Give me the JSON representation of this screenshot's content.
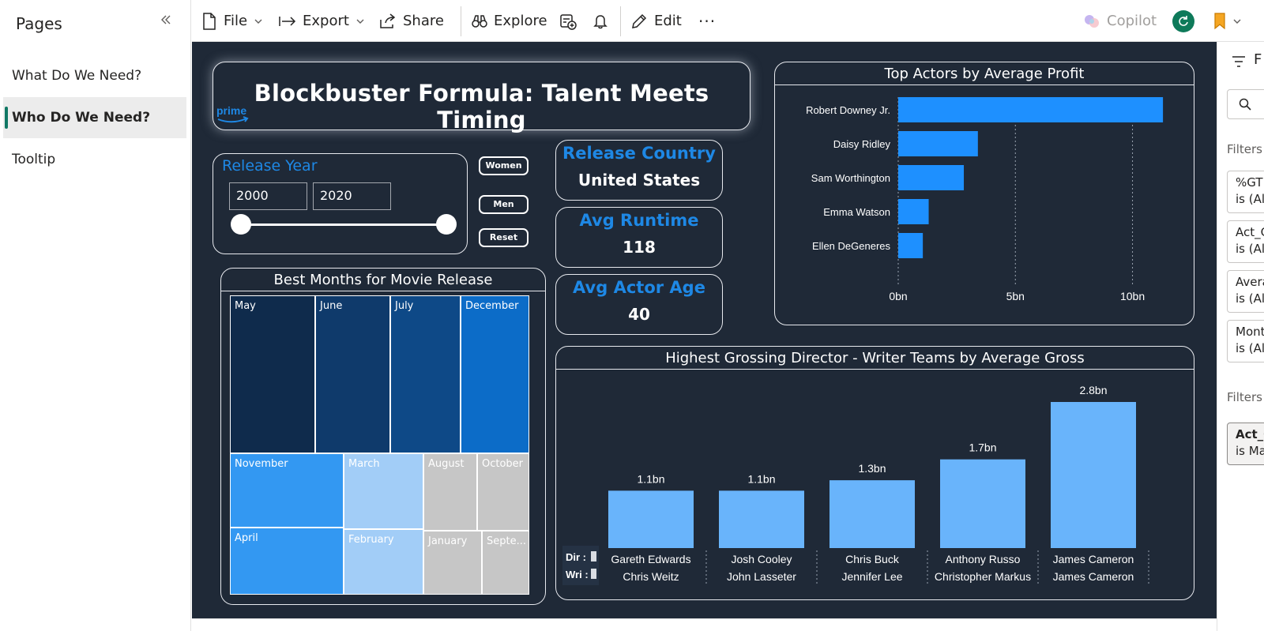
{
  "pages_pane": {
    "title": "Pages",
    "items": [
      {
        "label": "What Do We Need?",
        "active": false
      },
      {
        "label": "Who Do We Need?",
        "active": true
      },
      {
        "label": "Tooltip",
        "active": false
      }
    ]
  },
  "toolbar": {
    "file": "File",
    "export": "Export",
    "share": "Share",
    "explore": "Explore",
    "edit": "Edit",
    "more": "···",
    "copilot": "Copilot"
  },
  "report": {
    "title": "Blockbuster Formula: Talent Meets Timing",
    "logo_text": "prime",
    "release_year": {
      "label": "Release Year",
      "from": "2000",
      "to": "2020",
      "range_fraction": [
        0,
        1
      ]
    },
    "buttons": {
      "women": "Women",
      "men": "Men",
      "reset": "Reset"
    },
    "kpis": [
      {
        "label": "Release Country",
        "value": "United States"
      },
      {
        "label": "Avg Runtime",
        "value": "118"
      },
      {
        "label": "Avg Actor Age",
        "value": "40"
      }
    ]
  },
  "colors": {
    "canvas_bg": "#1f2937",
    "accent_blue": "#1e88e5",
    "bar_actor": "#1e90ff",
    "bar_director": "#69b4fb",
    "active_page_marker": "#117865"
  },
  "chart_data": [
    {
      "type": "heatmap",
      "title": "Best Months for Movie Release",
      "cells": [
        {
          "label": "May",
          "color": "#0f2b4c"
        },
        {
          "label": "June",
          "color": "#0f3a6b"
        },
        {
          "label": "July",
          "color": "#0e4987"
        },
        {
          "label": "December",
          "color": "#0c6cc8"
        },
        {
          "label": "November",
          "color": "#3398f2"
        },
        {
          "label": "March",
          "color": "#a2cdf7"
        },
        {
          "label": "August",
          "color": "#c6c6c6"
        },
        {
          "label": "October",
          "color": "#c6c6c6"
        },
        {
          "label": "April",
          "color": "#3398f2"
        },
        {
          "label": "February",
          "color": "#a2cdf7"
        },
        {
          "label": "January",
          "color": "#c6c6c6"
        },
        {
          "label": "Septe...",
          "color": "#c6c6c6"
        }
      ]
    },
    {
      "type": "bar",
      "orientation": "horizontal",
      "title": "Top Actors by Average Profit",
      "categories": [
        "Robert Downey Jr.",
        "Daisy Ridley",
        "Sam Worthington",
        "Emma Watson",
        "Ellen DeGeneres"
      ],
      "values": [
        11.3,
        3.4,
        2.8,
        1.3,
        1.05
      ],
      "unit": "bn",
      "xlim": [
        0,
        12
      ],
      "ticks": [
        "0bn",
        "5bn",
        "10bn"
      ],
      "grid": true
    },
    {
      "type": "bar",
      "title": "Highest Grossing Director - Writer Teams by Average Gross",
      "categories": [
        {
          "director": "Gareth Edwards",
          "writer": "Chris Weitz"
        },
        {
          "director": "Josh Cooley",
          "writer": "John Lasseter"
        },
        {
          "director": "Chris Buck",
          "writer": "Jennifer Lee"
        },
        {
          "director": "Anthony Russo",
          "writer": "Christopher Markus"
        },
        {
          "director": "James Cameron",
          "writer": "James Cameron"
        }
      ],
      "values": [
        1.1,
        1.1,
        1.3,
        1.7,
        2.8
      ],
      "data_labels": [
        "1.1bn",
        "1.1bn",
        "1.3bn",
        "1.7bn",
        "2.8bn"
      ],
      "row_labels": [
        "Dir :",
        "Wri :"
      ],
      "ylim": [
        0,
        3
      ]
    }
  ],
  "filters_pane": {
    "heading": "F",
    "section_page": "Filters o",
    "page_filters": [
      {
        "name": "%GT",
        "state": "is (All"
      },
      {
        "name": "Act_G",
        "state": "is (All"
      },
      {
        "name": "Avera",
        "state": "is (All"
      },
      {
        "name": "Mont",
        "state": "is (All"
      }
    ],
    "section_all": "Filters o",
    "all_filters": [
      {
        "name": "Act_G",
        "state": "is Ma"
      }
    ]
  }
}
